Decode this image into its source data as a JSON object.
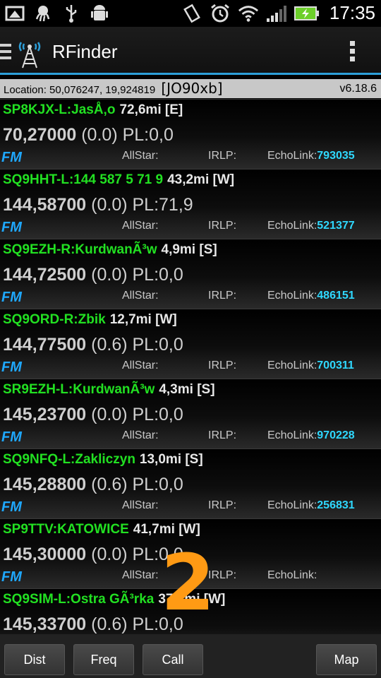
{
  "status_bar": {
    "time": "17:35",
    "icons": [
      "screenshot-icon",
      "octopus-icon",
      "usb-icon",
      "android-debug-icon",
      "rotate-icon",
      "alarm-icon",
      "wifi-icon",
      "signal-icon",
      "battery-charging-icon"
    ]
  },
  "action_bar": {
    "title": "RFinder",
    "icons": [
      "menu-icon",
      "antenna-tower-icon",
      "overflow-menu-icon"
    ]
  },
  "location_bar": {
    "location": "Location: 50,076247, 19,924819",
    "grid": "[JO90xb]",
    "version": "v6.18.6"
  },
  "repeaters": [
    {
      "call": "SP8KJX-L:JasÅ‚o",
      "dist": "72,6mi [E]",
      "freq": "70,27000",
      "offset": "(0.0)",
      "pl": "PL:0,0",
      "mode": "FM",
      "allstar": "AllStar:",
      "irlp": "IRLP:",
      "echolink_label": "EchoLink:",
      "echolink": "793035"
    },
    {
      "call": "SQ9HHT-L:144 587 5 71 9",
      "dist": "43,2mi [W]",
      "freq": "144,58700",
      "offset": "(0.0)",
      "pl": "PL:71,9",
      "mode": "FM",
      "allstar": "AllStar:",
      "irlp": "IRLP:",
      "echolink_label": "EchoLink:",
      "echolink": "521377"
    },
    {
      "call": "SQ9EZH-R:KurdwanÃ³w",
      "dist": "4,9mi [S]",
      "freq": "144,72500",
      "offset": "(0.0)",
      "pl": "PL:0,0",
      "mode": "FM",
      "allstar": "AllStar:",
      "irlp": "IRLP:",
      "echolink_label": "EchoLink:",
      "echolink": "486151"
    },
    {
      "call": "SQ9ORD-R:Zbik",
      "dist": "12,7mi [W]",
      "freq": "144,77500",
      "offset": "(0.6)",
      "pl": "PL:0,0",
      "mode": "FM",
      "allstar": "AllStar:",
      "irlp": "IRLP:",
      "echolink_label": "EchoLink:",
      "echolink": "700311"
    },
    {
      "call": "SR9EZH-L:KurdwanÃ³w",
      "dist": "4,3mi [S]",
      "freq": "145,23700",
      "offset": "(0.0)",
      "pl": "PL:0,0",
      "mode": "FM",
      "allstar": "AllStar:",
      "irlp": "IRLP:",
      "echolink_label": "EchoLink:",
      "echolink": "970228"
    },
    {
      "call": "SQ9NFQ-L:Zakliczyn",
      "dist": "13,0mi [S]",
      "freq": "145,28800",
      "offset": "(0.6)",
      "pl": "PL:0,0",
      "mode": "FM",
      "allstar": "AllStar:",
      "irlp": "IRLP:",
      "echolink_label": "EchoLink:",
      "echolink": "256831"
    },
    {
      "call": "SP9TTV:KATOWICE",
      "dist": "41,7mi [W]",
      "freq": "145,30000",
      "offset": "(0.0)",
      "pl": "PL:0,0",
      "mode": "FM",
      "allstar": "AllStar:",
      "irlp": "IRLP:",
      "echolink_label": "EchoLink:",
      "echolink": ""
    },
    {
      "call": "SQ9SIM-L:Ostra GÃ³rka",
      "dist": "37,3mi [W]",
      "freq": "145,33700",
      "offset": "(0.6)",
      "pl": "PL:0,0",
      "mode": "",
      "allstar": "",
      "irlp": "",
      "echolink_label": "",
      "echolink": ""
    }
  ],
  "overlay_number": "2",
  "bottom_buttons": {
    "dist": "Dist",
    "freq": "Freq",
    "call": "Call",
    "map": "Map"
  }
}
